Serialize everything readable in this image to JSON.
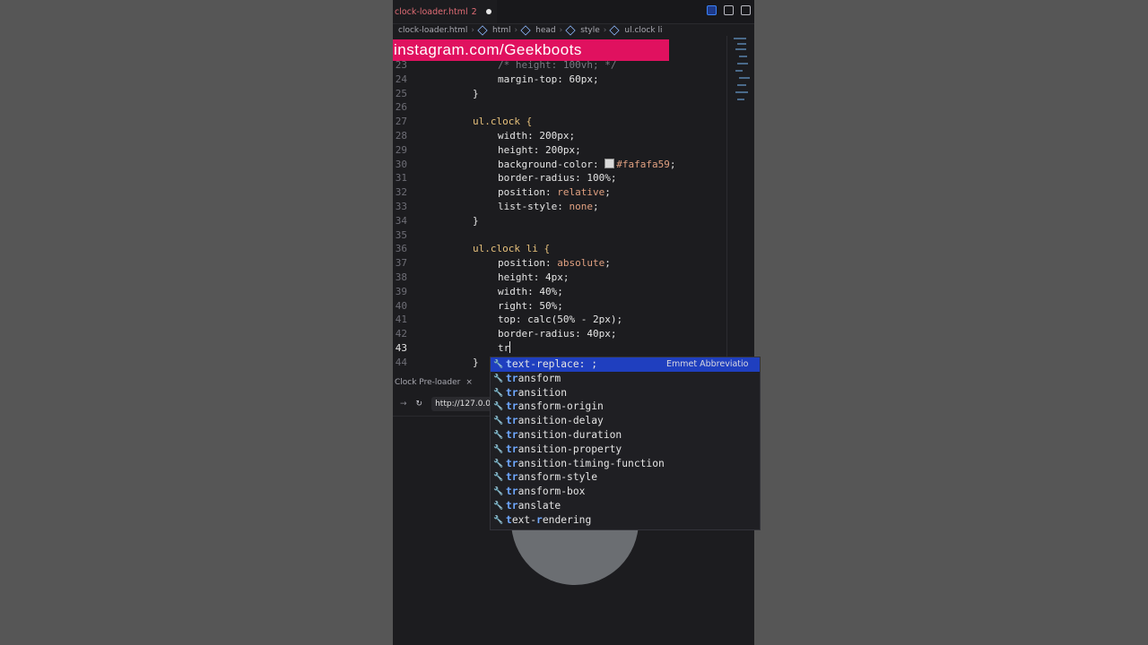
{
  "editor": {
    "tab": {
      "filename": "clock-loader.html",
      "problems": "2"
    },
    "breadcrumb": [
      "clock-loader.html",
      "html",
      "head",
      "style",
      "ul.clock li"
    ],
    "banner": "instagram.com/Geekboots",
    "lines": [
      {
        "n": "23",
        "parts": [
          {
            "c": "cmt",
            "t": "/* height: 100vh; */"
          }
        ],
        "indent": 2
      },
      {
        "n": "24",
        "parts": [
          {
            "c": "prop",
            "t": "margin-top"
          },
          {
            "c": "num",
            "t": ": 60px;"
          }
        ],
        "indent": 2
      },
      {
        "n": "25",
        "parts": [
          {
            "c": "prop",
            "t": "}"
          }
        ],
        "indent": 1
      },
      {
        "n": "26",
        "parts": [],
        "indent": 1
      },
      {
        "n": "27",
        "parts": [
          {
            "c": "sel",
            "t": "ul.clock {"
          }
        ],
        "indent": 1
      },
      {
        "n": "28",
        "parts": [
          {
            "c": "prop",
            "t": "width"
          },
          {
            "c": "num",
            "t": ": 200px;"
          }
        ],
        "indent": 2
      },
      {
        "n": "29",
        "parts": [
          {
            "c": "prop",
            "t": "height"
          },
          {
            "c": "num",
            "t": ": 200px;"
          }
        ],
        "indent": 2
      },
      {
        "n": "30",
        "parts": [
          {
            "c": "prop",
            "t": "background-color: "
          },
          {
            "c": "swatch",
            "t": ""
          },
          {
            "c": "val",
            "t": "#fafafa59"
          },
          {
            "c": "prop",
            "t": ";"
          }
        ],
        "indent": 2
      },
      {
        "n": "31",
        "parts": [
          {
            "c": "prop",
            "t": "border-radius"
          },
          {
            "c": "num",
            "t": ": 100%;"
          }
        ],
        "indent": 2
      },
      {
        "n": "32",
        "parts": [
          {
            "c": "prop",
            "t": "position: "
          },
          {
            "c": "val",
            "t": "relative"
          },
          {
            "c": "prop",
            "t": ";"
          }
        ],
        "indent": 2
      },
      {
        "n": "33",
        "parts": [
          {
            "c": "prop",
            "t": "list-style: "
          },
          {
            "c": "val",
            "t": "none"
          },
          {
            "c": "prop",
            "t": ";"
          }
        ],
        "indent": 2
      },
      {
        "n": "34",
        "parts": [
          {
            "c": "prop",
            "t": "}"
          }
        ],
        "indent": 1
      },
      {
        "n": "35",
        "parts": [],
        "indent": 1
      },
      {
        "n": "36",
        "parts": [
          {
            "c": "sel",
            "t": "ul.clock li {"
          }
        ],
        "indent": 1
      },
      {
        "n": "37",
        "parts": [
          {
            "c": "prop",
            "t": "position: "
          },
          {
            "c": "val",
            "t": "absolute"
          },
          {
            "c": "prop",
            "t": ";"
          }
        ],
        "indent": 2
      },
      {
        "n": "38",
        "parts": [
          {
            "c": "prop",
            "t": "height"
          },
          {
            "c": "num",
            "t": ": 4px;"
          }
        ],
        "indent": 2
      },
      {
        "n": "39",
        "parts": [
          {
            "c": "prop",
            "t": "width"
          },
          {
            "c": "num",
            "t": ": 40%;"
          }
        ],
        "indent": 2
      },
      {
        "n": "40",
        "parts": [
          {
            "c": "prop",
            "t": "right"
          },
          {
            "c": "num",
            "t": ": 50%;"
          }
        ],
        "indent": 2
      },
      {
        "n": "41",
        "parts": [
          {
            "c": "prop",
            "t": "top"
          },
          {
            "c": "num",
            "t": ": calc(50% - 2px);"
          }
        ],
        "indent": 2
      },
      {
        "n": "42",
        "parts": [
          {
            "c": "prop",
            "t": "border-radius"
          },
          {
            "c": "num",
            "t": ": 40px;"
          }
        ],
        "indent": 2
      },
      {
        "n": "43",
        "parts": [
          {
            "c": "prop",
            "t": "tr"
          },
          {
            "c": "cursor",
            "t": ""
          }
        ],
        "indent": 2,
        "active": true
      },
      {
        "n": "44",
        "parts": [
          {
            "c": "prop",
            "t": "}"
          }
        ],
        "indent": 1
      }
    ]
  },
  "autocomplete": {
    "items": [
      {
        "match": "t",
        "label": "ext-replace: ;",
        "match2": "",
        "rest2": "",
        "detail": "Emmet Abbreviatio",
        "selected": true
      },
      {
        "match": "tr",
        "label": "ansform"
      },
      {
        "match": "tr",
        "label": "ansition"
      },
      {
        "match": "tr",
        "label": "ansform-origin"
      },
      {
        "match": "tr",
        "label": "ansition-delay"
      },
      {
        "match": "tr",
        "label": "ansition-duration"
      },
      {
        "match": "tr",
        "label": "ansition-property"
      },
      {
        "match": "tr",
        "label": "ansition-timing-function"
      },
      {
        "match": "tr",
        "label": "ansform-style"
      },
      {
        "match": "tr",
        "label": "ansform-box"
      },
      {
        "match": "tr",
        "label": "anslate"
      },
      {
        "match": "t",
        "label": "ext-",
        "match2": "r",
        "rest2": "endering"
      }
    ]
  },
  "preview": {
    "tab_title": "Clock Pre-loader",
    "url": "http://127.0.0.1:5500/clock-loader.html"
  }
}
